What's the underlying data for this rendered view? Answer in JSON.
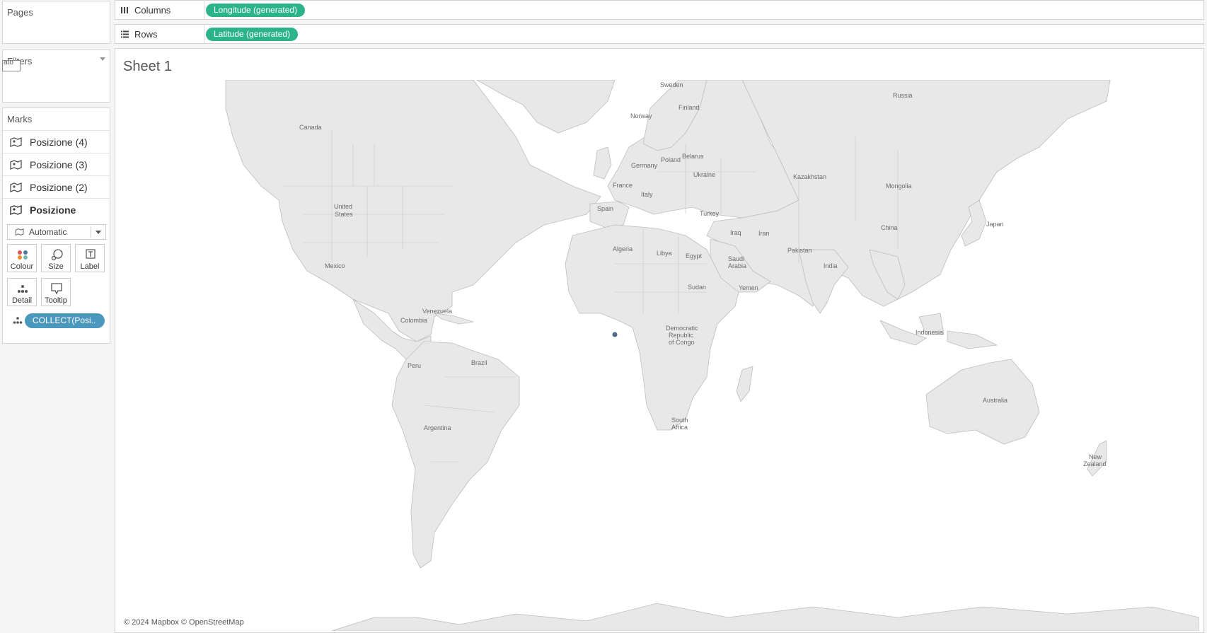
{
  "cards": {
    "pages_title": "Pages",
    "filters_title": "Filters",
    "filters_stub": "ato",
    "marks_title": "Marks"
  },
  "marks": {
    "layers": [
      {
        "label": "Posizione (4)",
        "active": false
      },
      {
        "label": "Posizione (3)",
        "active": false
      },
      {
        "label": "Posizione (2)",
        "active": false
      },
      {
        "label": "Posizione",
        "active": true
      }
    ],
    "mark_type": "Automatic",
    "buttons": {
      "colour": "Colour",
      "size": "Size",
      "label": "Label",
      "detail": "Detail",
      "tooltip": "Tooltip"
    },
    "detail_pill": "COLLECT(Posi.."
  },
  "shelves": {
    "columns_label": "Columns",
    "columns_pill": "Longitude (generated)",
    "rows_label": "Rows",
    "rows_pill": "Latitude (generated)"
  },
  "sheet": {
    "title": "Sheet 1",
    "attribution": "© 2024 Mapbox © OpenStreetMap"
  },
  "map": {
    "labels": {
      "sweden": "Sweden",
      "finland": "Finland",
      "russia": "Russia",
      "norway": "Norway",
      "canada": "Canada",
      "poland": "Poland",
      "belarus": "Belarus",
      "germany": "Germany",
      "ukraine": "Ukraine",
      "kazakhstan": "Kazakhstan",
      "france": "France",
      "italy": "Italy",
      "mongolia": "Mongolia",
      "united_states_1": "United",
      "united_states_2": "States",
      "spain": "Spain",
      "turkey": "Turkey",
      "japan": "Japan",
      "iraq": "Iraq",
      "iran": "Iran",
      "china": "China",
      "algeria": "Algeria",
      "libya": "Libya",
      "egypt": "Egypt",
      "pakistan": "Pakistan",
      "saudi_1": "Saudi",
      "saudi_2": "Arabia",
      "mexico": "Mexico",
      "india": "India",
      "sudan": "Sudan",
      "yemen": "Yemen",
      "venezuela": "Venezuela",
      "colombia": "Colombia",
      "indonesia": "Indonesia",
      "drc_1": "Democratic",
      "drc_2": "Republic",
      "drc_3": "of Congo",
      "brazil": "Brazil",
      "peru": "Peru",
      "australia": "Australia",
      "argentina": "Argentina",
      "south_africa_1": "South",
      "south_africa_2": "Africa",
      "new_zealand_1": "New",
      "new_zealand_2": "Zealand"
    },
    "land_color": "#e8e8e8",
    "border_color": "#b8b8b8",
    "mark_color": "#4e6b8a",
    "data_point": {
      "longitude": 0,
      "latitude": 0
    }
  }
}
